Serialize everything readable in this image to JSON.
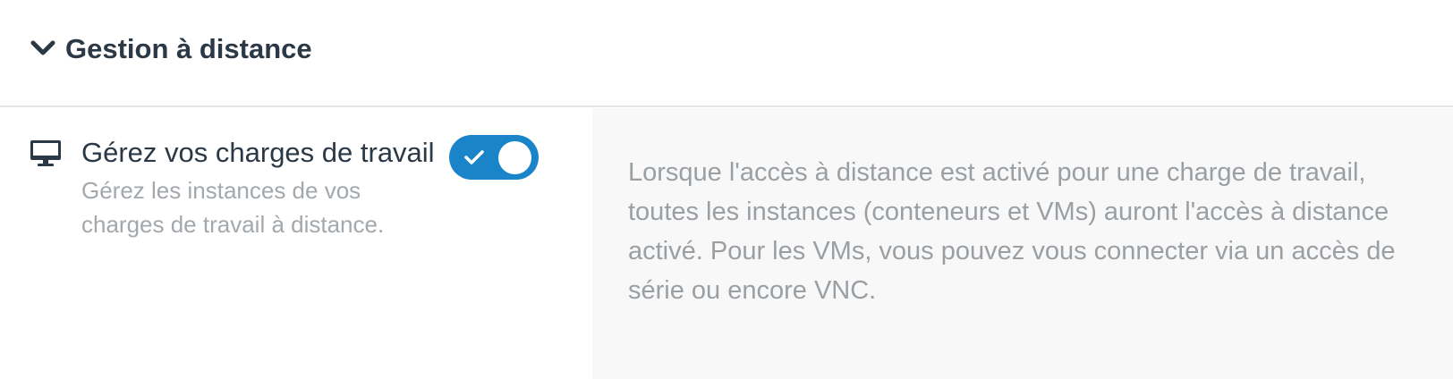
{
  "section": {
    "title": "Gestion à distance",
    "expanded": true
  },
  "setting": {
    "icon": "monitor-icon",
    "title": "Gérez vos charges de travail",
    "description": "Gérez les instances de vos charges de travail à distance.",
    "toggle_enabled": true
  },
  "help": {
    "text": "Lorsque l'accès à distance est activé pour une charge de travail, toutes les instances (conteneurs et VMs) auront l'accès à distance activé. Pour les VMs, vous pouvez vous connecter via un accès de série ou encore VNC."
  },
  "colors": {
    "accent": "#1a84c8",
    "title": "#2b3846",
    "muted": "#a3a8ad",
    "help_bg": "#f8f8f8"
  }
}
